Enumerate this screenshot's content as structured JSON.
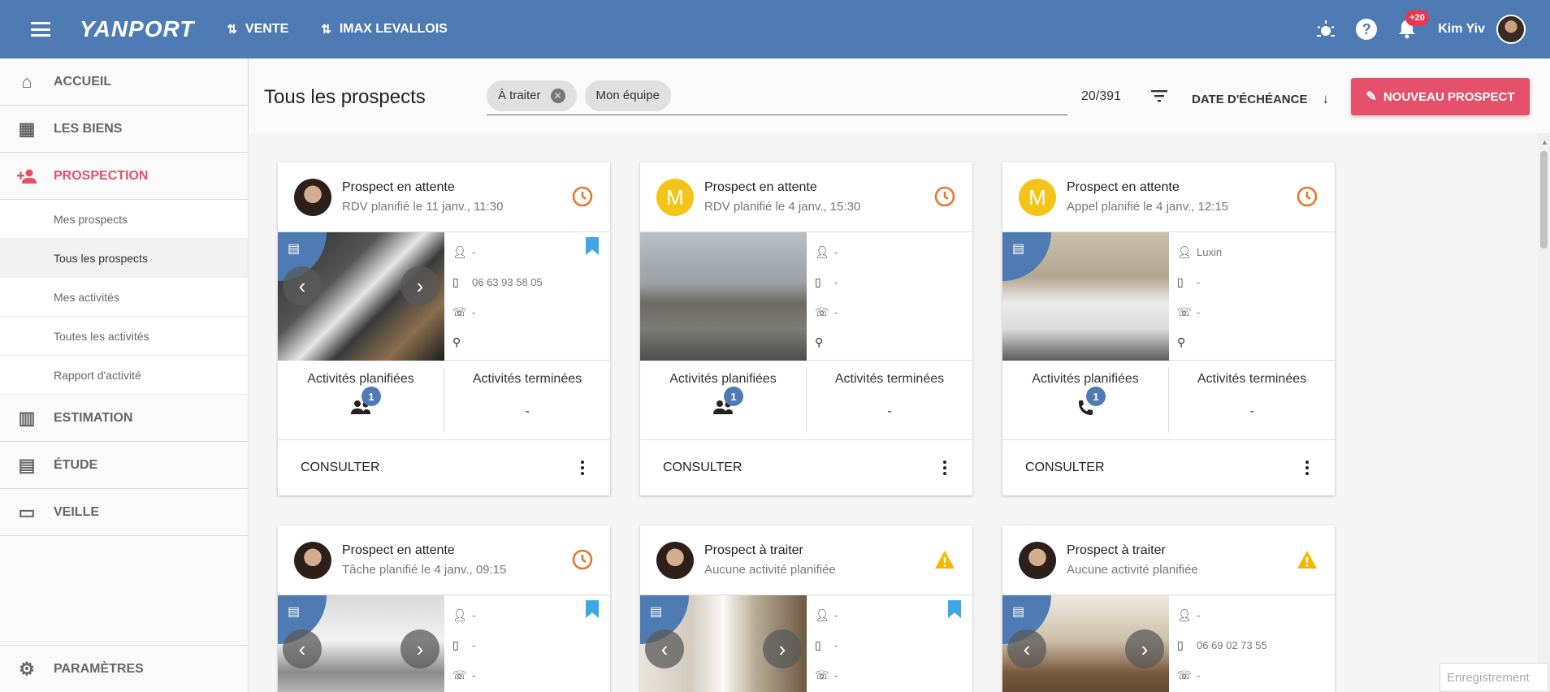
{
  "header": {
    "logo": "YANPORT",
    "nav": [
      {
        "label": "VENTE"
      },
      {
        "label": "IMAX LEVALLOIS"
      }
    ],
    "notif_count": "+20",
    "user_name": "Kim Yiv"
  },
  "sidebar": {
    "items": [
      {
        "label": "ACCUEIL",
        "icon": "home-icon"
      },
      {
        "label": "LES BIENS",
        "icon": "buildings-icon"
      },
      {
        "label": "PROSPECTION",
        "icon": "person-add-icon"
      },
      {
        "label": "ESTIMATION",
        "icon": "chart-icon"
      },
      {
        "label": "ÉTUDE",
        "icon": "library-icon"
      },
      {
        "label": "VEILLE",
        "icon": "cast-icon"
      }
    ],
    "subitems": [
      {
        "label": "Mes prospects"
      },
      {
        "label": "Tous les prospects"
      },
      {
        "label": "Mes activités"
      },
      {
        "label": "Toutes les activités"
      },
      {
        "label": "Rapport d'activité"
      }
    ],
    "settings_label": "PARAMÈTRES"
  },
  "main": {
    "title": "Tous les prospects",
    "chips": [
      {
        "label": "À traiter"
      },
      {
        "label": "Mon équipe"
      }
    ],
    "count": "20/391",
    "sort_label": "DATE D'ÉCHÉANCE",
    "new_button": "NOUVEAU PROSPECT"
  },
  "cards": [
    {
      "title": "Prospect en attente",
      "subtitle": "RDV planifié le 11 janv., 11:30",
      "person": "-",
      "phone": "06 63 93 58 05",
      "tel": "-",
      "planned_label": "Activités planifiées",
      "done_label": "Activités terminées",
      "planned_count": "1",
      "done_value": "-",
      "consult": "CONSULTER"
    },
    {
      "title": "Prospect en attente",
      "subtitle": "RDV planifié le 4 janv., 15:30",
      "avatar_letter": "M",
      "person": "-",
      "phone": "-",
      "tel": "-",
      "planned_label": "Activités planifiées",
      "done_label": "Activités terminées",
      "planned_count": "1",
      "done_value": "-",
      "consult": "CONSULTER"
    },
    {
      "title": "Prospect en attente",
      "subtitle": "Appel planifié le 4 janv., 12:15",
      "avatar_letter": "M",
      "person": "Luxin",
      "phone": "-",
      "tel": "-",
      "planned_label": "Activités planifiées",
      "done_label": "Activités terminées",
      "planned_count": "1",
      "done_value": "-",
      "consult": "CONSULTER"
    },
    {
      "title": "Prospect en attente",
      "subtitle": "Tâche planifié le 4 janv., 09:15",
      "person": "-",
      "phone": "-",
      "tel": "-"
    },
    {
      "title": "Prospect à traiter",
      "subtitle": "Aucune activité planifiée",
      "person": "-",
      "phone": "-",
      "tel": "-"
    },
    {
      "title": "Prospect à traiter",
      "subtitle": "Aucune activité planifiée",
      "person": "-",
      "phone": "06 69 02 73 55",
      "tel": "-"
    }
  ],
  "recording_label": "Enregistrement",
  "colors": {
    "brand": "#4e7bb3",
    "accent": "#e5506a",
    "warning": "#f5b800",
    "pending": "#e8772e"
  }
}
